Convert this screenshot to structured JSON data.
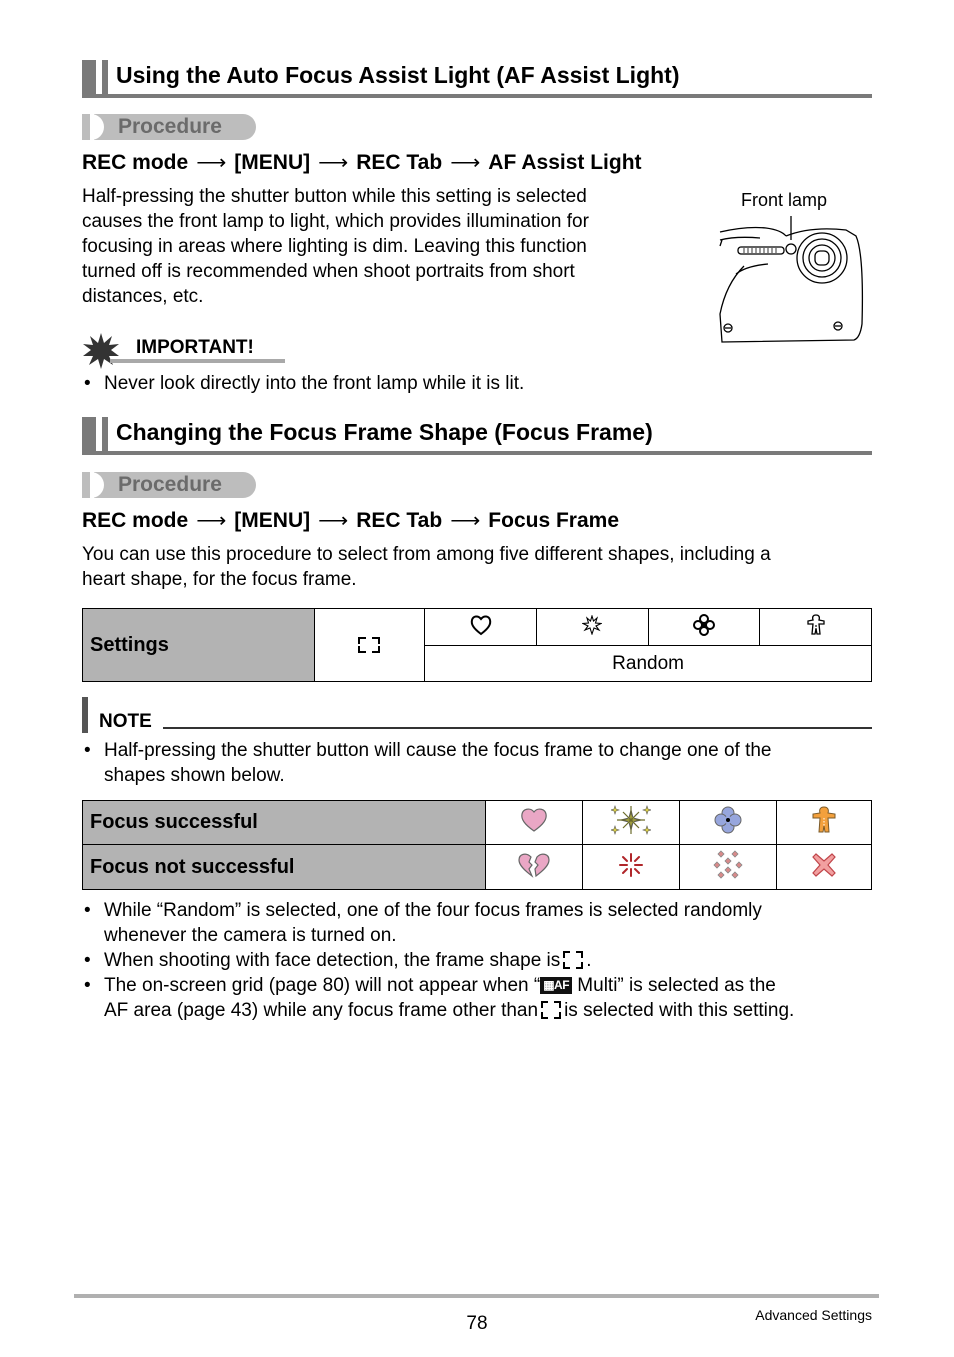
{
  "section1": {
    "title": "Using the Auto Focus Assist Light (AF Assist Light)",
    "procedure_label": "Procedure",
    "path": [
      "REC mode",
      "[MENU]",
      "REC Tab",
      "AF Assist Light"
    ],
    "arrow": "⟶",
    "body": "Half-pressing the shutter button while this setting is selected causes the front lamp to light, which provides illumination for focusing in areas where lighting is dim. Leaving this function turned off is recommended when shoot portraits from short distances, etc.",
    "body_lines": [
      "Half-pressing the shutter button while this setting is selected",
      "causes the front lamp to light, which provides illumination for",
      "focusing in areas where lighting is dim. Leaving this function",
      "turned off is recommended when shoot portraits from short",
      "distances, etc."
    ],
    "figure_label": "Front lamp",
    "important": {
      "label": "IMPORTANT!",
      "bullets": [
        "Never look directly into the front lamp while it is lit."
      ]
    }
  },
  "section2": {
    "title": "Changing the Focus Frame Shape (Focus Frame)",
    "procedure_label": "Procedure",
    "path": [
      "REC mode",
      "[MENU]",
      "REC Tab",
      "Focus Frame"
    ],
    "body_lines": [
      "You can use this procedure to select from among five different shapes, including a",
      "heart shape, for the focus frame."
    ],
    "settings_table": {
      "header": "Settings",
      "options": [
        "bracket-frame-icon",
        "heart-outline-icon",
        "sparkle-outline-icon",
        "flower-outline-icon",
        "gingerbread-outline-icon"
      ],
      "random_label": "Random"
    },
    "note": {
      "label": "NOTE",
      "bullets_top": [
        [
          "Half-pressing the shutter button will cause the focus frame to change one of the",
          "shapes shown below."
        ]
      ]
    },
    "focus_table": {
      "rows": [
        {
          "label": "Focus successful",
          "icons": [
            "pink-heart-icon",
            "yellow-sparkle-icon",
            "blue-flower-icon",
            "orange-gingerbread-icon"
          ]
        },
        {
          "label": "Focus not successful",
          "icons": [
            "broken-heart-icon",
            "red-burst-icon",
            "scattered-diamonds-icon",
            "red-x-icon"
          ]
        }
      ]
    },
    "bullets_bottom": {
      "b1_l1": "While “Random” is selected, one of the four focus frames is selected randomly",
      "b1_l2": "whenever the camera is turned on.",
      "b2_pre": "When shooting with face detection, the frame shape is",
      "b2_post": ".",
      "b3_l1_pre": "The on-screen grid (page 80) will not appear when “",
      "b3_af_icon": "▦AF",
      "b3_l1_post": " Multi” is selected as the",
      "b3_l2_pre": "AF area (page 43) while any focus frame other than",
      "b3_l2_post": "is selected with this setting."
    }
  },
  "footer": {
    "page_number": "78",
    "section_name": "Advanced Settings"
  },
  "bullet_char": "•"
}
